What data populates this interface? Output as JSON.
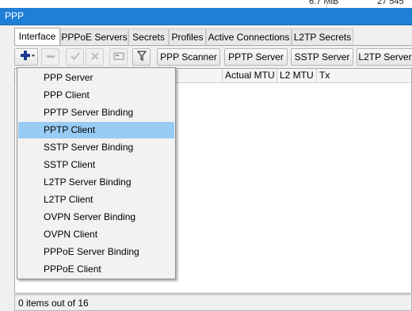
{
  "background": {
    "text_left": "6.7 MiB",
    "text_right": "27 545"
  },
  "window": {
    "title": "PPP"
  },
  "tabs": [
    {
      "label": "Interface",
      "active": true
    },
    {
      "label": "PPPoE Servers",
      "active": false
    },
    {
      "label": "Secrets",
      "active": false
    },
    {
      "label": "Profiles",
      "active": false
    },
    {
      "label": "Active Connections",
      "active": false
    },
    {
      "label": "L2TP Secrets",
      "active": false
    }
  ],
  "toolbar": {
    "add_icon": "plus-icon",
    "remove_icon": "minus-icon",
    "enable_icon": "check-icon",
    "disable_icon": "x-icon",
    "comment_icon": "comment-icon",
    "filter_icon": "filter-icon",
    "buttons": [
      "PPP Scanner",
      "PPTP Server",
      "SSTP Server",
      "L2TP Server"
    ]
  },
  "table": {
    "columns": [
      "Actual MTU",
      "L2 MTU",
      "Tx"
    ]
  },
  "status": {
    "text": "0 items out of 16"
  },
  "menu": {
    "items": [
      {
        "label": "PPP Server",
        "highlighted": false
      },
      {
        "label": "PPP Client",
        "highlighted": false
      },
      {
        "label": "PPTP Server Binding",
        "highlighted": false
      },
      {
        "label": "PPTP Client",
        "highlighted": true
      },
      {
        "label": "SSTP Server Binding",
        "highlighted": false
      },
      {
        "label": "SSTP Client",
        "highlighted": false
      },
      {
        "label": "L2TP Server Binding",
        "highlighted": false
      },
      {
        "label": "L2TP Client",
        "highlighted": false
      },
      {
        "label": "OVPN Server Binding",
        "highlighted": false
      },
      {
        "label": "OVPN Client",
        "highlighted": false
      },
      {
        "label": "PPPoE Server Binding",
        "highlighted": false
      },
      {
        "label": "PPPoE Client",
        "highlighted": false
      }
    ]
  },
  "colors": {
    "titlebar": "#1f7fd6",
    "highlight": "#99ccf5",
    "add_icon": "#1a3a8f"
  }
}
